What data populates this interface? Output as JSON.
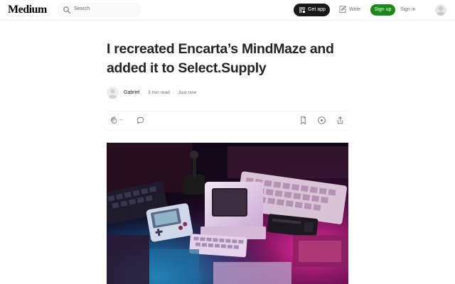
{
  "header": {
    "logo": "Medium",
    "search_placeholder": "Search",
    "get_app_label": "Get app",
    "write_label": "Write",
    "signup_label": "Sign up",
    "signin_label": "Sign in"
  },
  "article": {
    "title": "I recreated Encarta’s MindMaze and added it to Select.Supply",
    "author": "Gabriel",
    "read_time": "3 min read",
    "separator": "·",
    "published": "Just now",
    "clap_count": "--"
  },
  "colors": {
    "accent_green": "#1a8917",
    "dark_button": "#191919",
    "muted_text": "#6b6b6b"
  },
  "icons": [
    "search-icon",
    "get-app-icon",
    "write-icon",
    "clap-icon",
    "comment-icon",
    "bookmark-icon",
    "play-icon",
    "share-icon"
  ]
}
